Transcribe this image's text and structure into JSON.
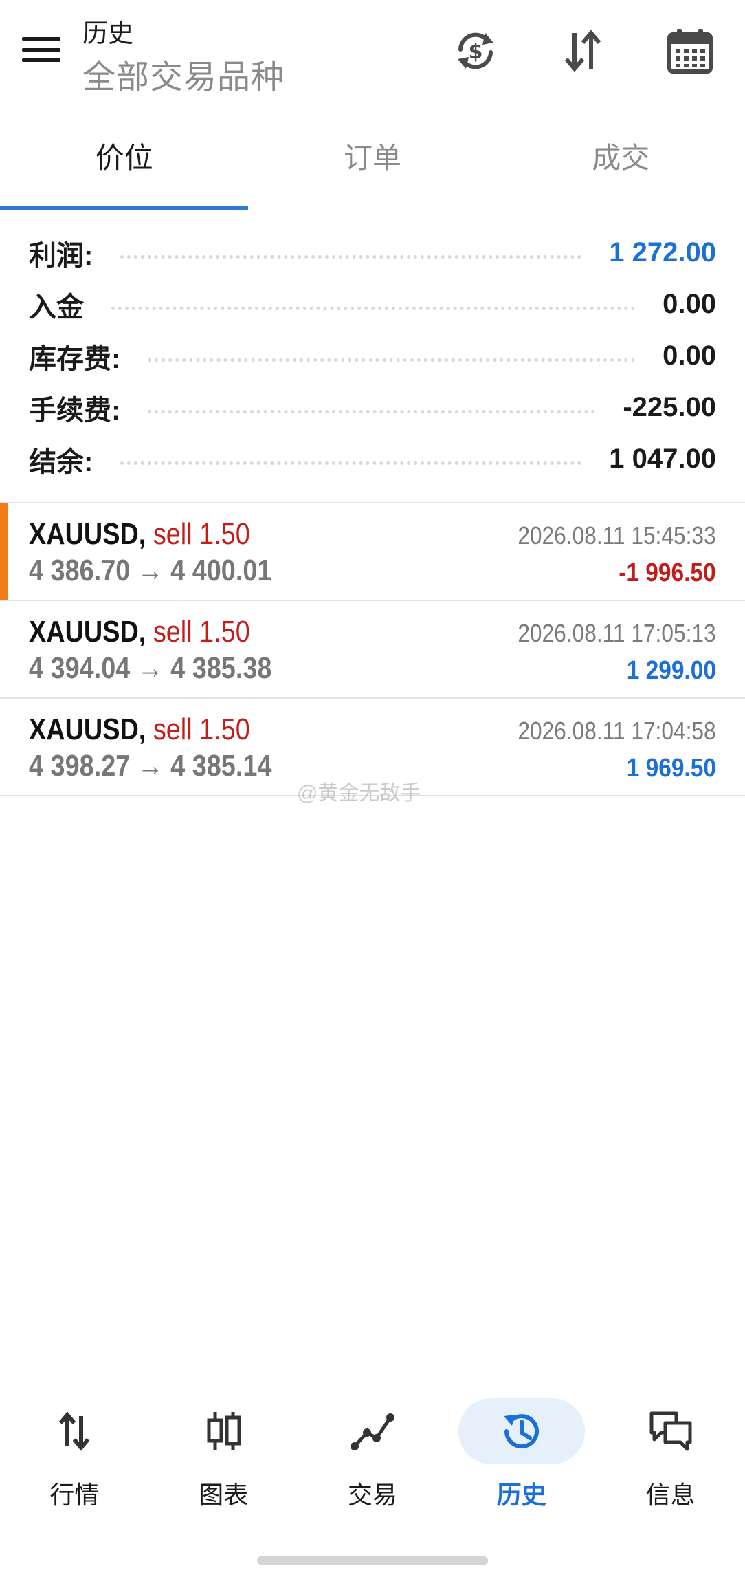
{
  "header": {
    "title": "历史",
    "subtitle": "全部交易品种"
  },
  "tabs": [
    {
      "label": "价位",
      "active": true
    },
    {
      "label": "订单",
      "active": false
    },
    {
      "label": "成交",
      "active": false
    }
  ],
  "summary": [
    {
      "label": "利润:",
      "value": "1 272.00",
      "color": "#1b6fd8"
    },
    {
      "label": "入金",
      "value": "0.00",
      "color": "#1a1a1a"
    },
    {
      "label": "库存费:",
      "value": "0.00",
      "color": "#1a1a1a"
    },
    {
      "label": "手续费:",
      "value": "-225.00",
      "color": "#1a1a1a"
    },
    {
      "label": "结余:",
      "value": "1 047.00",
      "color": "#1a1a1a"
    }
  ],
  "trades": [
    {
      "symbol": "XAUUSD,",
      "side": "sell 1.50",
      "prices": "4 386.70 → 4 400.01",
      "time": "2026.08.11 15:45:33",
      "profit": "-1 996.50",
      "profit_color": "#c61b1b",
      "highlighted": true
    },
    {
      "symbol": "XAUUSD,",
      "side": "sell 1.50",
      "prices": "4 394.04 → 4 385.38",
      "time": "2026.08.11 17:05:13",
      "profit": "1 299.00",
      "profit_color": "#1b6fd8",
      "highlighted": false
    },
    {
      "symbol": "XAUUSD,",
      "side": "sell 1.50",
      "prices": "4 398.27 → 4 385.14",
      "time": "2026.08.11 17:04:58",
      "profit": "1 969.50",
      "profit_color": "#1b6fd8",
      "highlighted": false
    }
  ],
  "watermark": "@黄金无敌手",
  "bottom_nav": [
    {
      "label": "行情",
      "icon": "quotes-arrows-icon",
      "active": false
    },
    {
      "label": "图表",
      "icon": "candlestick-chart-icon",
      "active": false
    },
    {
      "label": "交易",
      "icon": "trade-line-icon",
      "active": false
    },
    {
      "label": "历史",
      "icon": "history-clock-icon",
      "active": true
    },
    {
      "label": "信息",
      "icon": "messages-icon",
      "active": false
    }
  ],
  "colors": {
    "accent": "#2b7bd6",
    "profit_positive": "#1b6fd8",
    "profit_negative": "#c61b1b",
    "highlight_marker": "#f07d1a"
  }
}
